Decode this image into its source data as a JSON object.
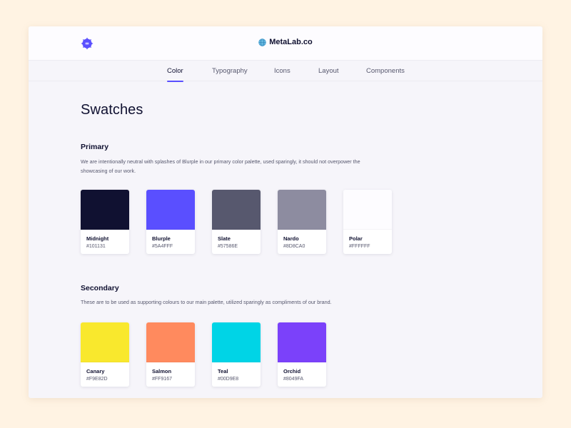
{
  "header": {
    "logo_icon": "blurple-badge-logo",
    "brand_icon": "globe-icon",
    "brand": "MetaLab.co"
  },
  "nav": {
    "active": "Color",
    "items": [
      {
        "label": "Color",
        "active": true
      },
      {
        "label": "Typography",
        "active": false
      },
      {
        "label": "Icons",
        "active": false
      },
      {
        "label": "Layout",
        "active": false
      },
      {
        "label": "Components",
        "active": false
      }
    ]
  },
  "page": {
    "title": "Swatches"
  },
  "sections": {
    "primary": {
      "title": "Primary",
      "description": "We are intentionally neutral with splashes of Blurple in our primary color palette, used sparingly, it should not overpower the showcasing of our work.",
      "swatches": [
        {
          "name": "Midnight",
          "hex": "#101131",
          "color": "#101131"
        },
        {
          "name": "Blurple",
          "hex": "#5A4FFF",
          "color": "#5A4FFF"
        },
        {
          "name": "Slate",
          "hex": "#57586E",
          "color": "#57586E"
        },
        {
          "name": "Nardo",
          "hex": "#8D8CA0",
          "color": "#8D8CA0"
        },
        {
          "name": "Polar",
          "hex": "#FFFFFF",
          "color": "#FDFCFF"
        }
      ]
    },
    "secondary": {
      "title": "Secondary",
      "description": "These are to be used as supporting colours to our main palette, utilized sparingly as compliments of our brand.",
      "swatches": [
        {
          "name": "Canary",
          "hex": "#F9E82D",
          "color": "#F9E82D"
        },
        {
          "name": "Salmon",
          "hex": "#FF9167",
          "color": "#FF8A5E"
        },
        {
          "name": "Teal",
          "hex": "#00D9E8",
          "color": "#00D4E6"
        },
        {
          "name": "Orchid",
          "hex": "#8049FA",
          "color": "#7B41FA"
        }
      ]
    }
  },
  "colors": {
    "accent": "#5A4FFF",
    "page_background": "#FFF3E3",
    "frame_background": "#F6F5FA"
  }
}
